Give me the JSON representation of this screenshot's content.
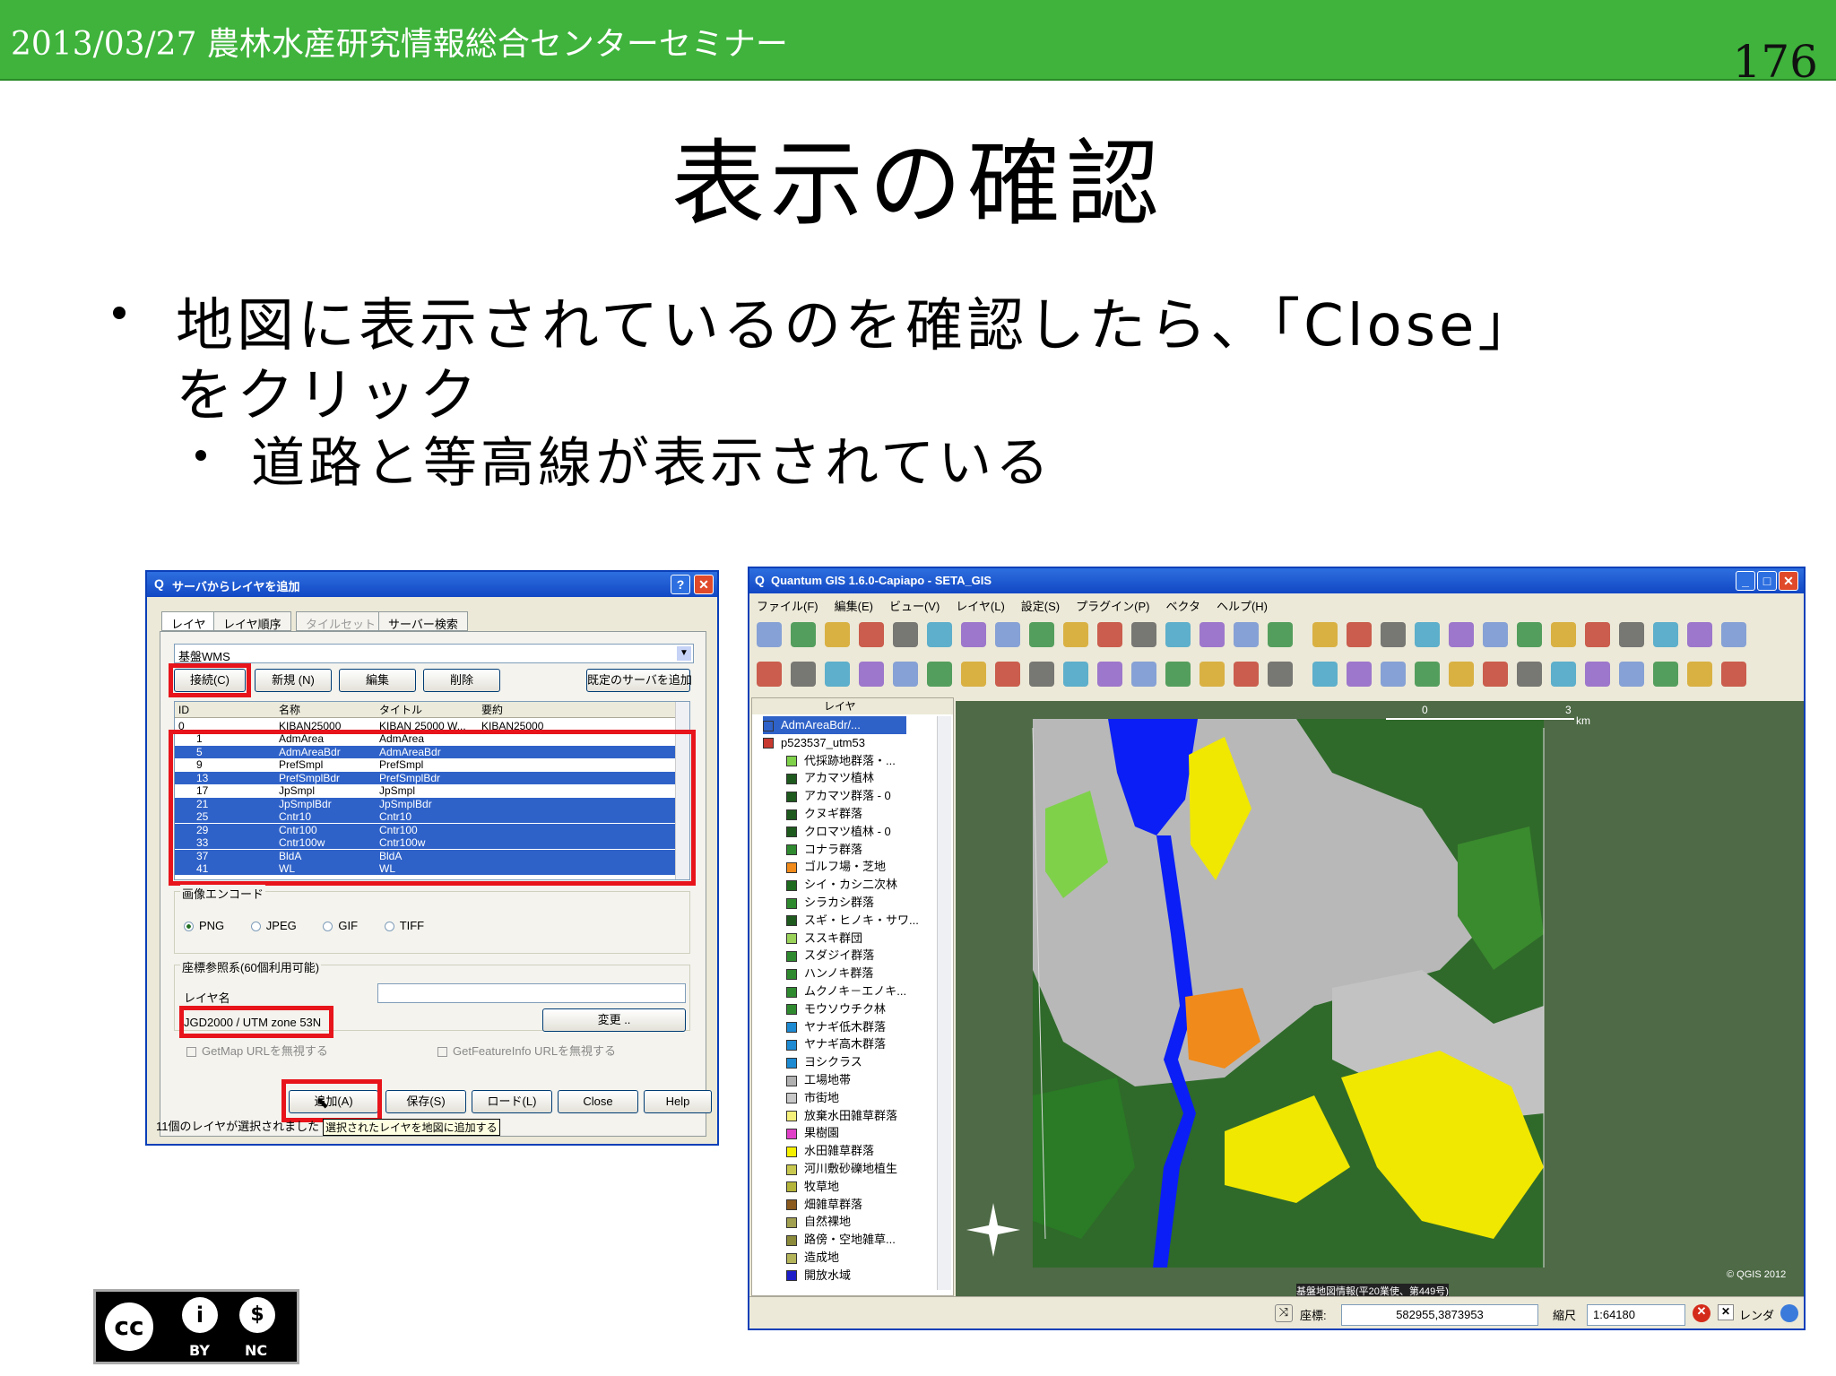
{
  "header": {
    "title": "2013/03/27 農林水産研究情報総合センターセミナー",
    "page_number": "176"
  },
  "slide": {
    "title": "表示の確認",
    "bullet1_line1": "地図に表示されているのを確認したら、「Close」",
    "bullet1_line2": "をクリック",
    "bullet2": "道路と等高線が表示されている"
  },
  "dialog": {
    "title": "サーバからレイヤを追加",
    "tabs": [
      "レイヤ",
      "レイヤ順序",
      "タイルセット",
      "サーバー検索"
    ],
    "server": "基盤WMS",
    "buttons": {
      "connect": "接続(C)",
      "new": "新規 (N)",
      "edit": "編集",
      "delete": "削除",
      "add_default": "既定のサーバを追加"
    },
    "columns": [
      "ID",
      "名称",
      "タイトル",
      "要約"
    ],
    "parent_row": [
      "0",
      "KIBAN25000",
      "KIBAN 25000 W...",
      "KIBAN25000"
    ],
    "rows": [
      {
        "id": "1",
        "name": "AdmArea",
        "title": "AdmArea"
      },
      {
        "id": "5",
        "name": "AdmAreaBdr",
        "title": "AdmAreaBdr"
      },
      {
        "id": "9",
        "name": "PrefSmpl",
        "title": "PrefSmpl"
      },
      {
        "id": "13",
        "name": "PrefSmplBdr",
        "title": "PrefSmplBdr"
      },
      {
        "id": "17",
        "name": "JpSmpl",
        "title": "JpSmpl"
      },
      {
        "id": "21",
        "name": "JpSmplBdr",
        "title": "JpSmplBdr"
      },
      {
        "id": "25",
        "name": "Cntr10",
        "title": "Cntr10"
      },
      {
        "id": "29",
        "name": "Cntr100",
        "title": "Cntr100"
      },
      {
        "id": "33",
        "name": "Cntr100w",
        "title": "Cntr100w"
      },
      {
        "id": "37",
        "name": "BldA",
        "title": "BldA"
      },
      {
        "id": "41",
        "name": "WL",
        "title": "WL"
      }
    ],
    "encoding_label": "画像エンコード",
    "encodings": [
      "PNG",
      "JPEG",
      "GIF",
      "TIFF"
    ],
    "crs_label": "座標参照系(60個利用可能)",
    "layer_name_label": "レイヤ名",
    "crs_value": "JGD2000 / UTM zone 53N",
    "change_button": "変更 ..",
    "ignore_getmap": "GetMap URLを無視する",
    "ignore_getfeature": "GetFeatureInfo URLを無視する",
    "bottom_buttons": {
      "add": "追加(A)",
      "save": "保存(S)",
      "load": "ロード(L)",
      "close": "Close",
      "help": "Help"
    },
    "status": "11個のレイヤが選択されました",
    "status_tail": "選択されたレイヤを地図に追加する"
  },
  "qgis": {
    "title": "Quantum GIS 1.6.0-Capiapo - SETA_GIS",
    "menu": [
      "ファイル(F)",
      "編集(E)",
      "ビュー(V)",
      "レイヤ(L)",
      "設定(S)",
      "プラグイン(P)",
      "ベクタ",
      "ヘルプ(H)"
    ],
    "layer_panel_title": "レイヤ",
    "layers": [
      {
        "label": "AdmAreaBdr/...",
        "color": "#2f62c8"
      },
      {
        "label": "p523537_utm53",
        "color": "#c83a2f"
      },
      {
        "label": "代採跡地群落・...",
        "color": "#7fd14a"
      },
      {
        "label": "アカマツ植林",
        "color": "#1e5a1e"
      },
      {
        "label": "アカマツ群落 - 0",
        "color": "#1e5a1e"
      },
      {
        "label": "クヌギ群落",
        "color": "#1e5a1e"
      },
      {
        "label": "クロマツ植林 - 0",
        "color": "#1e5a1e"
      },
      {
        "label": "コナラ群落",
        "color": "#2f8a2f"
      },
      {
        "label": "ゴルフ場・芝地",
        "color": "#f08a1a"
      },
      {
        "label": "シイ・カシ二次林",
        "color": "#1e6a1e"
      },
      {
        "label": "シラカシ群落",
        "color": "#2f8a2f"
      },
      {
        "label": "スギ・ヒノキ・サワ...",
        "color": "#1e5a1e"
      },
      {
        "label": "ススキ群団",
        "color": "#9ad25a"
      },
      {
        "label": "スダジイ群落",
        "color": "#2f8a2f"
      },
      {
        "label": "ハンノキ群落",
        "color": "#2f8a2f"
      },
      {
        "label": "ムクノキ－エノキ...",
        "color": "#2f8a2f"
      },
      {
        "label": "モウソウチク林",
        "color": "#2f8a2f"
      },
      {
        "label": "ヤナギ低木群落",
        "color": "#1e8ad2"
      },
      {
        "label": "ヤナギ高木群落",
        "color": "#1e8ad2"
      },
      {
        "label": "ヨシクラス",
        "color": "#1e8ad2"
      },
      {
        "label": "工場地帯",
        "color": "#b0b0b0"
      },
      {
        "label": "市街地",
        "color": "#c8c8c8"
      },
      {
        "label": "放棄水田雑草群落",
        "color": "#f5f07a"
      },
      {
        "label": "果樹園",
        "color": "#e040c8"
      },
      {
        "label": "水田雑草群落",
        "color": "#f5f000"
      },
      {
        "label": "河川敷砂礫地植生",
        "color": "#c8c850"
      },
      {
        "label": "牧草地",
        "color": "#b4b43a"
      },
      {
        "label": "畑雑草群落",
        "color": "#8a5a1e"
      },
      {
        "label": "自然裸地",
        "color": "#a0a050"
      },
      {
        "label": "路傍・空地雑草...",
        "color": "#8a8a3a"
      },
      {
        "label": "造成地",
        "color": "#b4b45a"
      },
      {
        "label": "開放水域",
        "color": "#1e1ec8"
      }
    ],
    "scale_bar": {
      "start": "0",
      "end": "3",
      "unit": "km"
    },
    "map_credit": "基盤地図情報(平20業使、第449号)",
    "map_copyright": "© QGIS 2012",
    "status": {
      "coord_label": "座標:",
      "coord_value": "582955,3873953",
      "scale_label": "縮尺",
      "scale_value": "1:64180",
      "render_label": "レンダ"
    }
  },
  "license": {
    "by": "BY",
    "nc": "NC"
  }
}
